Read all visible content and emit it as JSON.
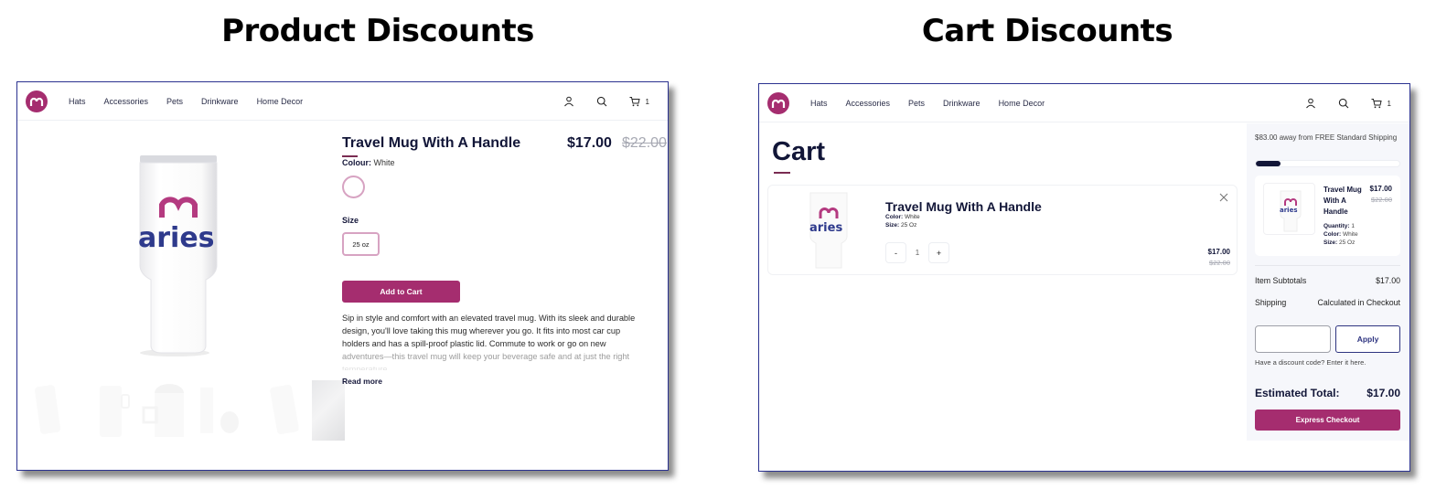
{
  "titles": {
    "left": "Product Discounts",
    "right": "Cart Discounts"
  },
  "nav": {
    "links": [
      "Hats",
      "Accessories",
      "Pets",
      "Drinkware",
      "Home Decor"
    ],
    "cart_count": "1",
    "icons": [
      "account-icon",
      "search-icon",
      "cart-icon"
    ]
  },
  "brand": {
    "accent": "#a52d6f",
    "navy": "#121638",
    "logo_text": "aries"
  },
  "product_page": {
    "title": "Travel Mug With A Handle",
    "price": "$17.00",
    "compare_price": "$22.00",
    "colour_label": "Colour:",
    "colour_value": "White",
    "size_label": "Size",
    "size_option": "25 oz",
    "add_to_cart": "Add to Cart",
    "description_lines": [
      "Sip in style and comfort with an elevated travel mug. With its sleek and durable",
      "design, you'll love taking this mug wherever you go. It fits into most car cup",
      "holders and has a spill-proof plastic lid. Commute to work or go on new",
      "adventures—this travel mug will keep your beverage safe and at just the right",
      "temperature."
    ],
    "read_more": "Read more",
    "thumbnail_count": 6
  },
  "cart_page": {
    "heading": "Cart",
    "item": {
      "title": "Travel Mug With A Handle",
      "color_label": "Color:",
      "color_value": "White",
      "size_label": "Size:",
      "size_value": "25 Oz",
      "quantity": "1",
      "decrement": "-",
      "increment": "+",
      "price": "$17.00",
      "compare_price": "$22.00"
    },
    "summary": {
      "shipping_message": "$83.00 away from FREE Standard Shipping",
      "shipping_progress_pct": 17,
      "card": {
        "title": "Travel Mug With A Handle",
        "price": "$17.00",
        "compare_price": "$22.00",
        "quantity_label": "Quantity:",
        "quantity_value": "1",
        "color_label": "Color:",
        "color_value": "White",
        "size_label": "Size:",
        "size_value": "25 Oz"
      },
      "subtotal_label": "Item Subtotals",
      "subtotal_value": "$17.00",
      "shipping_label": "Shipping",
      "shipping_value": "Calculated in Checkout",
      "discount_input_value": "",
      "discount_placeholder": "",
      "apply_label": "Apply",
      "discount_hint": "Have a discount code? Enter it here.",
      "total_label": "Estimated Total:",
      "total_value": "$17.00",
      "checkout_label": "Express Checkout"
    }
  }
}
